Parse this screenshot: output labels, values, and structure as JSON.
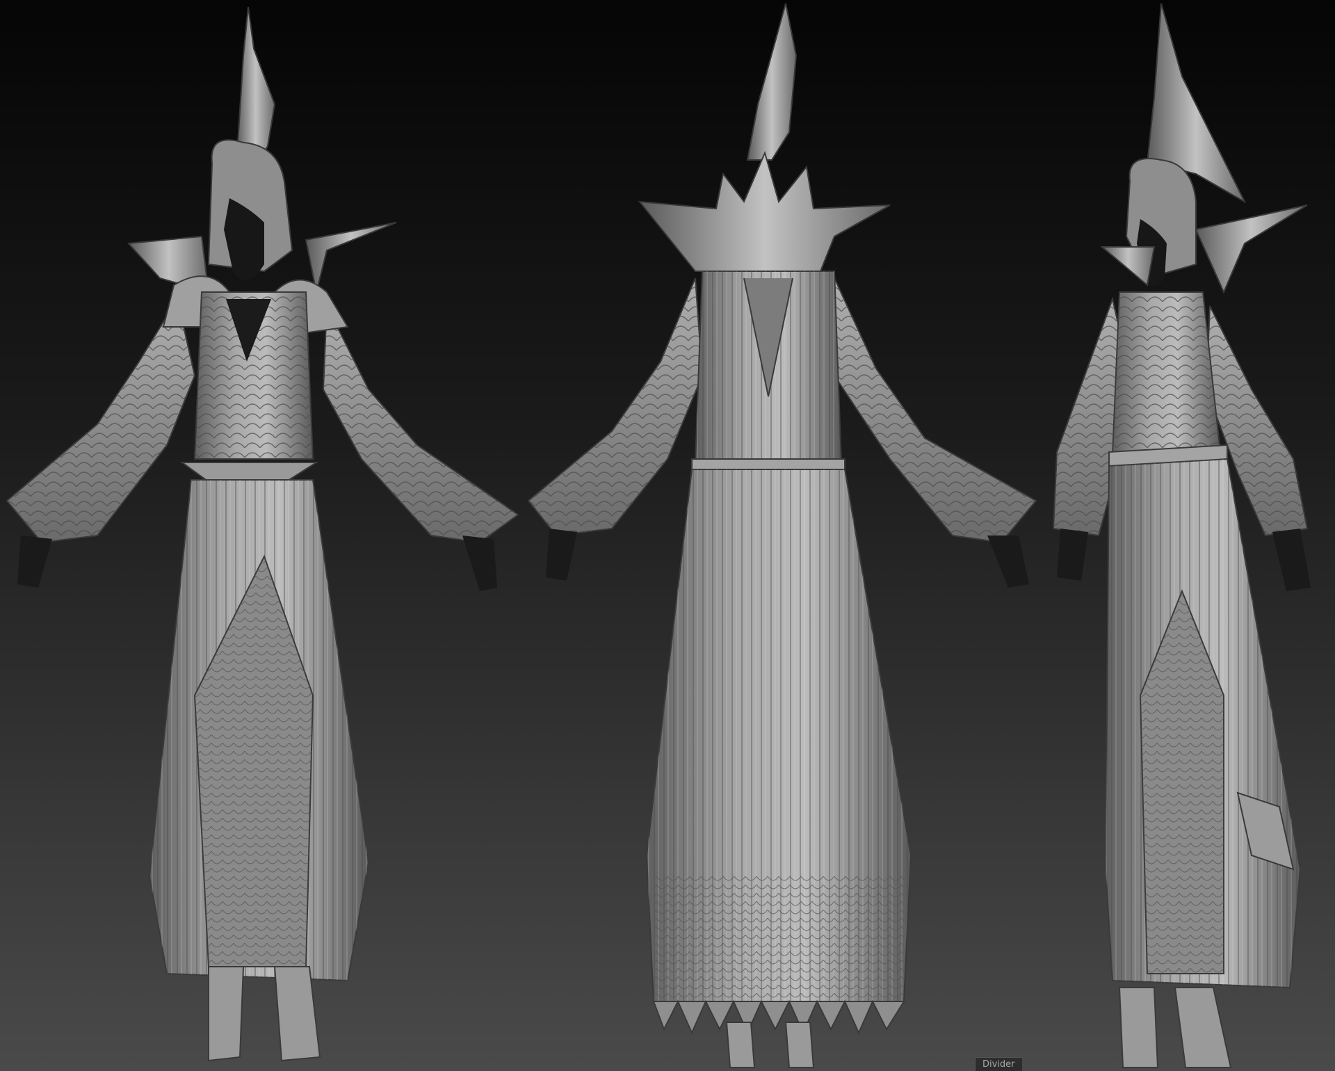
{
  "viewport": {
    "background_top": "#050505",
    "background_bottom": "#4a4a4a",
    "model_color": "#9a9a9a",
    "skin_color": "#1e1e1e"
  },
  "figures": [
    {
      "view": "front"
    },
    {
      "view": "back"
    },
    {
      "view": "three-quarter"
    }
  ],
  "tooltip": {
    "label": "Divider"
  }
}
